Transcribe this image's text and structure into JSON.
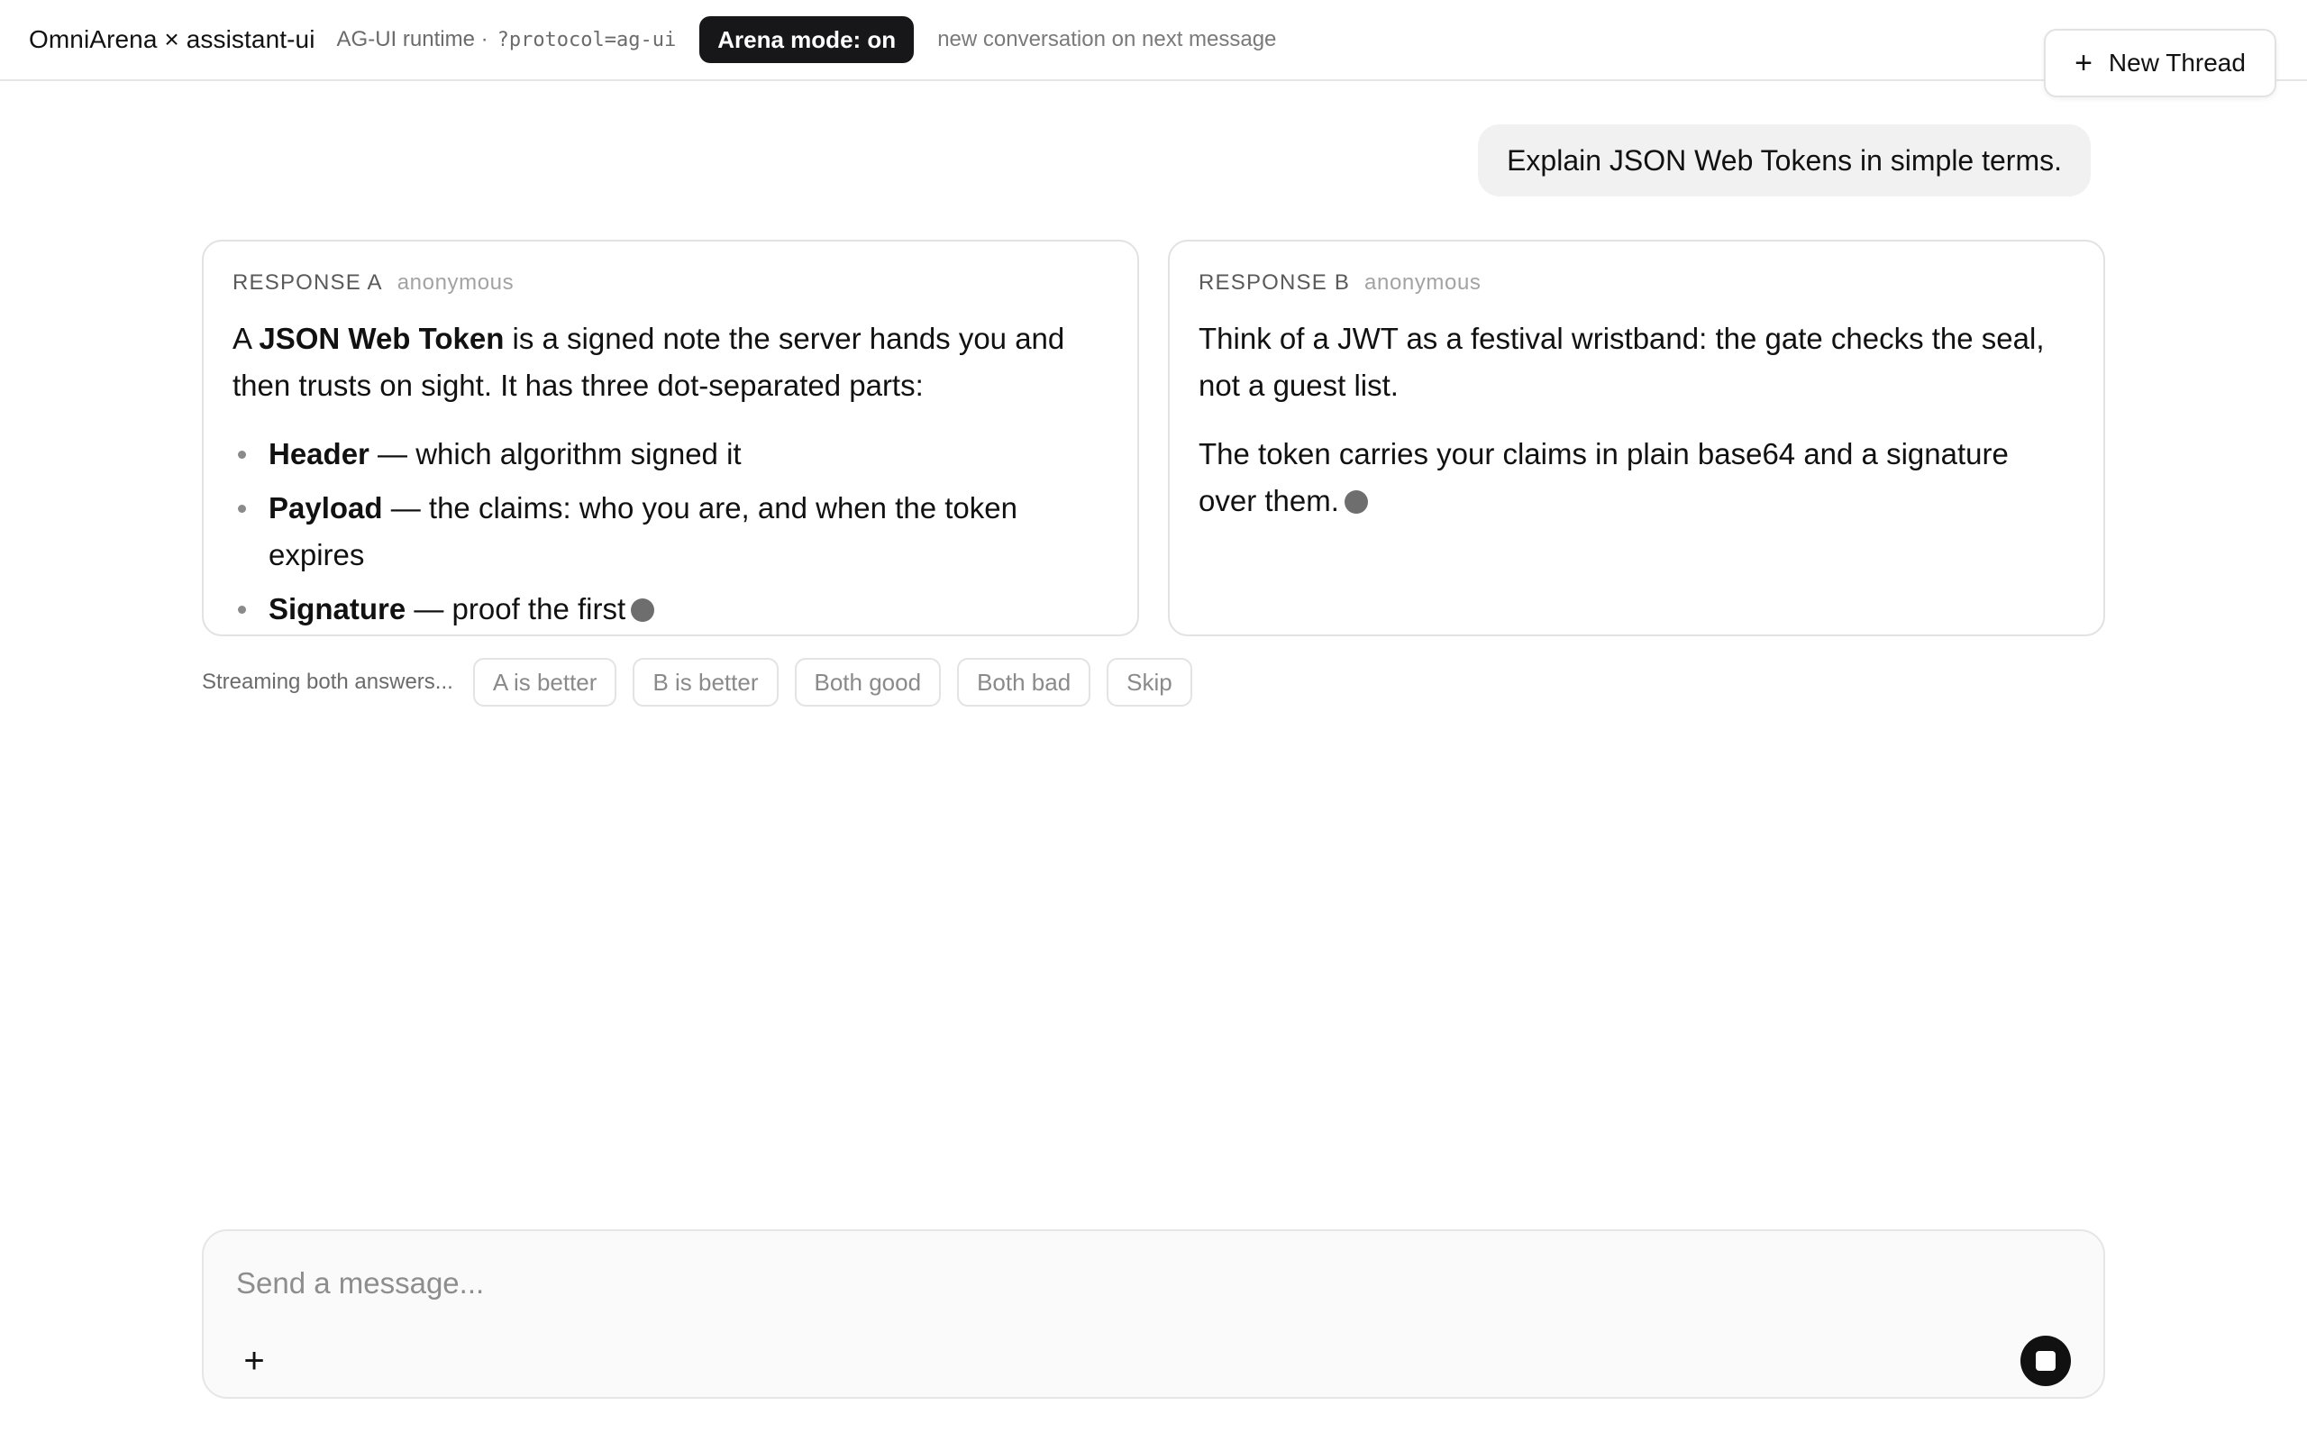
{
  "header": {
    "title": "OmniArena × assistant-ui",
    "runtime_label": "AG-UI runtime ·",
    "runtime_param": "?protocol=ag-ui",
    "arena_badge": "Arena mode: on",
    "hint": "new conversation on next message",
    "new_thread_label": "New Thread"
  },
  "user_message": "Explain JSON Web Tokens in simple terms.",
  "responses": {
    "a": {
      "label": "Response A",
      "anon": "anonymous",
      "intro_prefix": "A ",
      "intro_bold": "JSON Web Token",
      "intro_rest": " is a signed note the server hands you and then trusts on sight. It has three dot-separated parts:",
      "items": [
        {
          "bold": "Header",
          "rest": " — which algorithm signed it"
        },
        {
          "bold": "Payload",
          "rest": " — the claims: who you are, and when the token expires"
        },
        {
          "bold": "Signature",
          "rest": " — proof the first"
        }
      ]
    },
    "b": {
      "label": "Response B",
      "anon": "anonymous",
      "para1": "Think of a JWT as a festival wristband: the gate checks the seal, not a guest list.",
      "para2": "The token carries your claims in plain base64 and a signature over them."
    }
  },
  "vote": {
    "status": "Streaming both answers...",
    "buttons": [
      "A is better",
      "B is better",
      "Both good",
      "Both bad",
      "Skip"
    ]
  },
  "composer": {
    "placeholder": "Send a message..."
  }
}
